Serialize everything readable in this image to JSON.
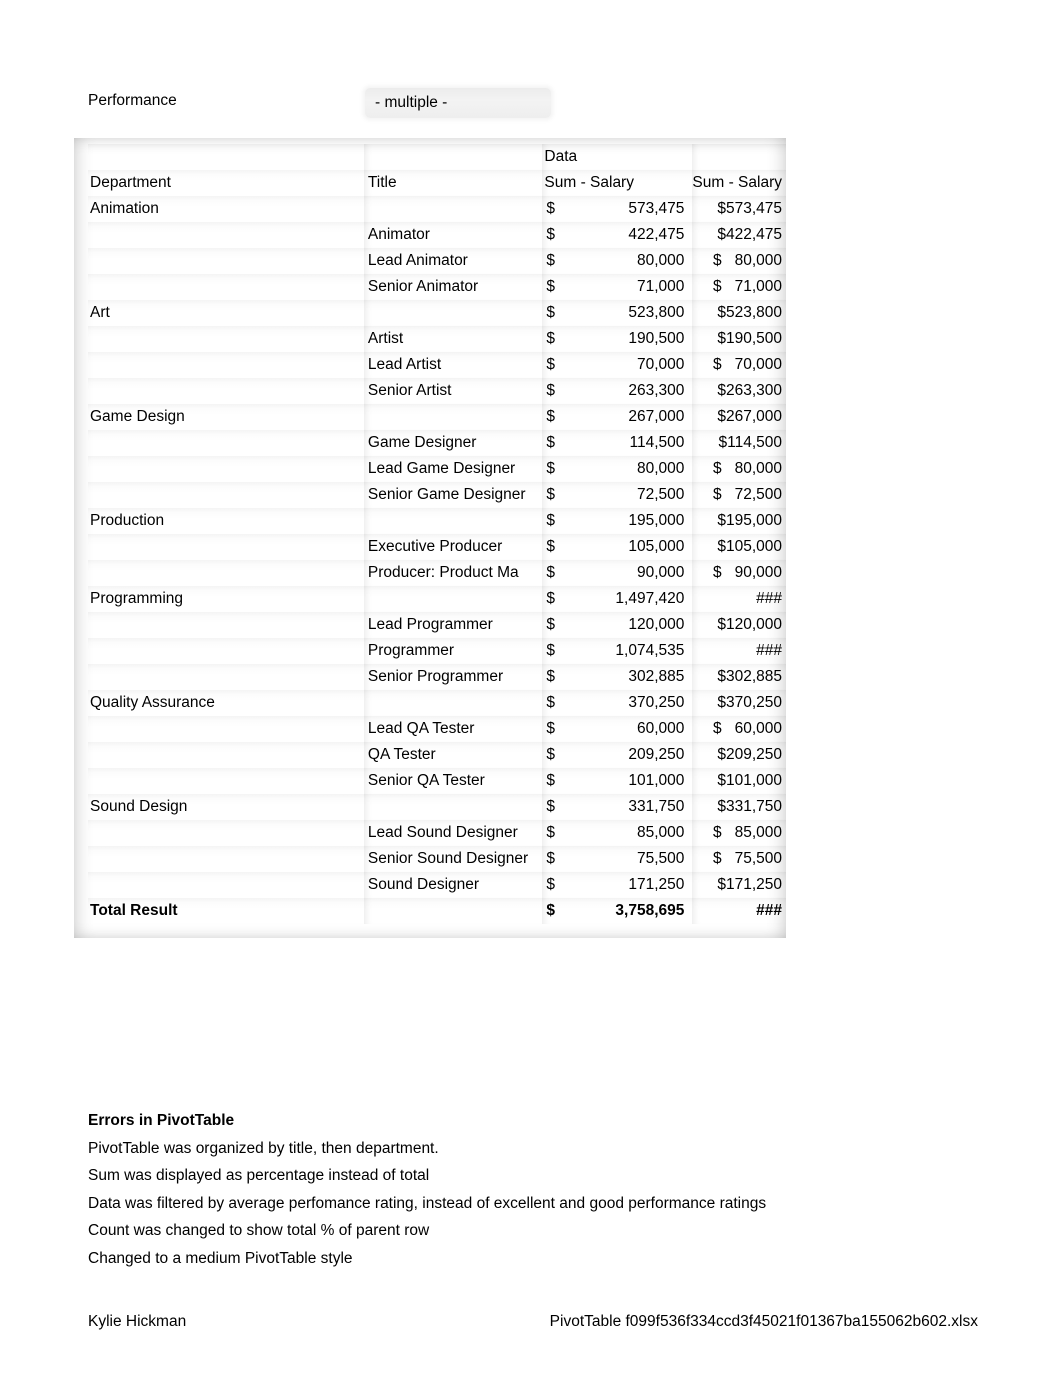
{
  "report": {
    "filter_label": "Performance",
    "filter_value": "- multiple -"
  },
  "pivot": {
    "data_header": "Data",
    "columns": {
      "department": "Department",
      "title": "Title",
      "sum_salary_1": "Sum - Salary",
      "sum_salary_2": "Sum - Salary"
    },
    "currency_symbol": "$",
    "overflow_marker": "###",
    "rows": [
      {
        "department": "Animation",
        "title": "",
        "amount": "573,475",
        "compact": "$573,475"
      },
      {
        "department": "",
        "title": "Animator",
        "amount": "422,475",
        "compact": "$422,475"
      },
      {
        "department": "",
        "title": "Lead Animator",
        "amount": "80,000",
        "compact": "$   80,000"
      },
      {
        "department": "",
        "title": "Senior Animator",
        "amount": "71,000",
        "compact": "$   71,000"
      },
      {
        "department": "Art",
        "title": "",
        "amount": "523,800",
        "compact": "$523,800"
      },
      {
        "department": "",
        "title": "Artist",
        "amount": "190,500",
        "compact": "$190,500"
      },
      {
        "department": "",
        "title": "Lead Artist",
        "amount": "70,000",
        "compact": "$   70,000"
      },
      {
        "department": "",
        "title": "Senior Artist",
        "amount": "263,300",
        "compact": "$263,300"
      },
      {
        "department": "Game Design",
        "title": "",
        "amount": "267,000",
        "compact": "$267,000"
      },
      {
        "department": "",
        "title": "Game Designer",
        "amount": "114,500",
        "compact": "$114,500"
      },
      {
        "department": "",
        "title": "Lead Game Designer",
        "amount": "80,000",
        "compact": "$   80,000"
      },
      {
        "department": "",
        "title": "Senior Game Designer",
        "amount": "72,500",
        "compact": "$   72,500"
      },
      {
        "department": "Production",
        "title": "",
        "amount": "195,000",
        "compact": "$195,000"
      },
      {
        "department": "",
        "title": "Executive Producer",
        "amount": "105,000",
        "compact": "$105,000"
      },
      {
        "department": "",
        "title": "Producer: Product Ma",
        "amount": "90,000",
        "compact": "$   90,000"
      },
      {
        "department": "Programming",
        "title": "",
        "amount": "1,497,420",
        "compact": "###"
      },
      {
        "department": "",
        "title": "Lead Programmer",
        "amount": "120,000",
        "compact": "$120,000"
      },
      {
        "department": "",
        "title": "Programmer",
        "amount": "1,074,535",
        "compact": "###"
      },
      {
        "department": "",
        "title": "Senior Programmer",
        "amount": "302,885",
        "compact": "$302,885"
      },
      {
        "department": "Quality Assurance",
        "title": "",
        "amount": "370,250",
        "compact": "$370,250"
      },
      {
        "department": "",
        "title": "Lead QA Tester",
        "amount": "60,000",
        "compact": "$   60,000"
      },
      {
        "department": "",
        "title": "QA Tester",
        "amount": "209,250",
        "compact": "$209,250"
      },
      {
        "department": "",
        "title": "Senior QA Tester",
        "amount": "101,000",
        "compact": "$101,000"
      },
      {
        "department": "Sound Design",
        "title": "",
        "amount": "331,750",
        "compact": "$331,750"
      },
      {
        "department": "",
        "title": "Lead Sound Designer",
        "amount": "85,000",
        "compact": "$   85,000"
      },
      {
        "department": "",
        "title": "Senior Sound Designer",
        "amount": "75,500",
        "compact": "$   75,500"
      },
      {
        "department": "",
        "title": "Sound Designer",
        "amount": "171,250",
        "compact": "$171,250"
      }
    ],
    "total": {
      "label": "Total Result",
      "amount": "3,758,695",
      "compact": "###"
    }
  },
  "notes": {
    "heading": "Errors in PivotTable",
    "lines": [
      "PivotTable was organized by title, then department.",
      "Sum was displayed as percentage instead of total",
      "Data was filtered by average perfomance rating, instead of excellent and good performance ratings",
      "Count was changed to show total % of parent row",
      "Changed to a medium PivotTable style"
    ]
  },
  "footer": {
    "author": "Kylie Hickman",
    "file": "PivotTable f099f536f334ccd3f45021f01367ba155062b602.xlsx"
  }
}
